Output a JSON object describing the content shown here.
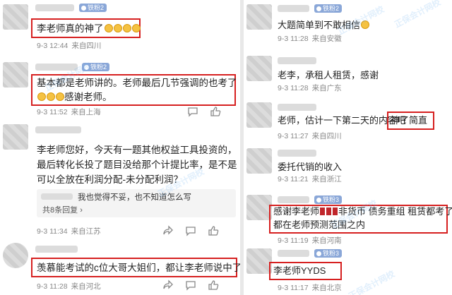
{
  "left": {
    "comments": [
      {
        "badge": "铁粉2",
        "text_lines": [
          "李老师真的神了"
        ],
        "time": "9-3 12:44",
        "location": "来自四川"
      },
      {
        "badge": "铁粉2",
        "text_lines": [
          "基本都是老师讲的。老师最后几节强调的也考了",
          "感谢老师。"
        ],
        "time": "9-3 11:52",
        "location": "来自上海"
      },
      {
        "badge": "",
        "text_lines": [
          "李老师您好，今天有一题其他权益工具投资的，",
          "最后转化长投了题目没给那个计提比率，是不是",
          "可以全放在利润分配-未分配利润？"
        ],
        "reply": "我也觉得不妥，也不知道怎么写",
        "reply_more": "共8条回复",
        "time": "9-3 11:34",
        "location": "来自江苏"
      },
      {
        "badge": "",
        "text_lines": [
          "羡慕能考试的c位大哥大姐们，都让李老师说中了"
        ],
        "time": "9-3 11:28",
        "location": "来自河北"
      }
    ]
  },
  "right": {
    "comments": [
      {
        "badge": "铁粉2",
        "text_lines": [
          "大题简单到不敢相信"
        ],
        "time": "9-3 11:28",
        "location": "来自安徽"
      },
      {
        "badge": "",
        "text_lines": [
          "老李，承租人租赁，感谢"
        ],
        "time": "9-3 11:28",
        "location": "来自广东"
      },
      {
        "badge": "",
        "text_lines": [
          "老师，估计一下第二天的内容吧"
        ],
        "highlight": "神了简直",
        "time": "9-3 11:27",
        "location": "来自四川"
      },
      {
        "badge": "",
        "text_lines": [
          "委托代销的收入"
        ],
        "time": "9-3 11:21",
        "location": "来自浙江"
      },
      {
        "badge": "铁粉3",
        "text_lines": [
          "感谢李老师",
          "非货币  债务重组  租赁都考了",
          "都在老师预测范围之内"
        ],
        "time": "9-3 11:19",
        "location": "来自河南"
      },
      {
        "badge": "铁粉3",
        "text_lines": [
          "李老师YYDS"
        ],
        "time": "9-3 11:17",
        "location": "来自北京"
      }
    ]
  },
  "watermark": "正保会计网校",
  "icons": [
    "comment-icon",
    "share-icon",
    "like-icon"
  ]
}
